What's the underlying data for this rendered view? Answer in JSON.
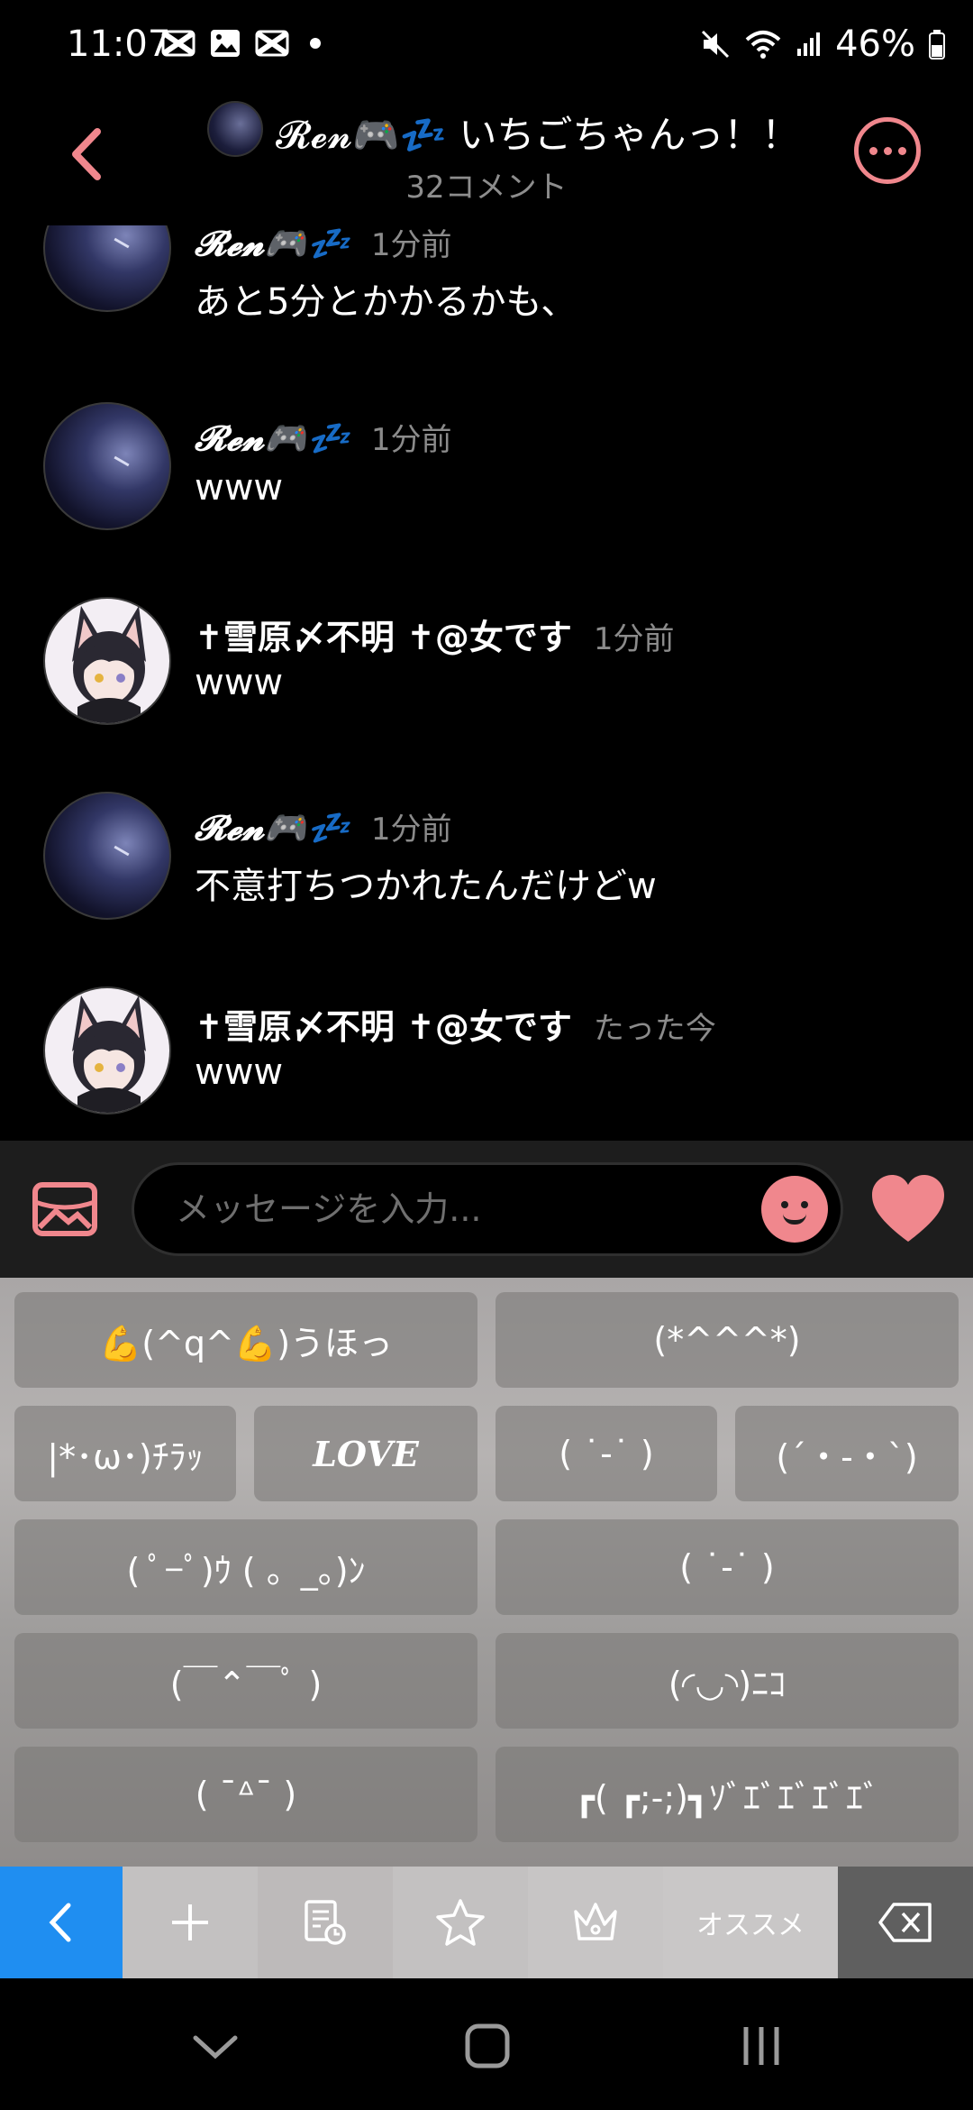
{
  "status_bar": {
    "time": "11:07",
    "battery": "46%"
  },
  "header": {
    "title": "𝓡𝓮𝓷🎮💤 いちごちゃんっ！！",
    "subtitle": "32コメント"
  },
  "comments": [
    {
      "name": "𝓡𝓮𝓷🎮💤",
      "time": "1分前",
      "text": "あと5分とかかるかも、",
      "avatar": "ren"
    },
    {
      "name": "𝓡𝓮𝓷🎮💤",
      "time": "1分前",
      "text": "www",
      "avatar": "ren"
    },
    {
      "name": "✝雪原〆不明 ✝@女です",
      "time": "1分前",
      "text": "www",
      "avatar": "yuki"
    },
    {
      "name": "𝓡𝓮𝓷🎮💤",
      "time": "1分前",
      "text": "不意打ちつかれたんだけどw",
      "avatar": "ren"
    },
    {
      "name": "✝雪原〆不明 ✝@女です",
      "time": "たった今",
      "text": "www",
      "avatar": "yuki"
    }
  ],
  "input": {
    "placeholder": "メッセージを入力..."
  },
  "kaomoji_keys": [
    "💪(^q^💪)うほっ",
    "(*^^^*)",
    "|*･ω･)ﾁﾗｯ",
    "LOVE",
    "( ˙-˙ )",
    "(´・-・`)",
    "( ﾟ−ﾟ)ｳ ( 。_。)ﾝ",
    "( ˙-˙ )",
    "(￣⌃￣ﾟ )",
    "(◜◡◝)ﾆｺ",
    "( ¯ᐞ¯ )",
    "┏( ┏;-;)┓ｿﾞｴﾞｴﾞｴﾞｴﾞ"
  ],
  "toolbar": {
    "recommend_label": "オススメ"
  },
  "colors": {
    "accent": "#f0878d",
    "keyboard_active": "#1f8ef1"
  }
}
